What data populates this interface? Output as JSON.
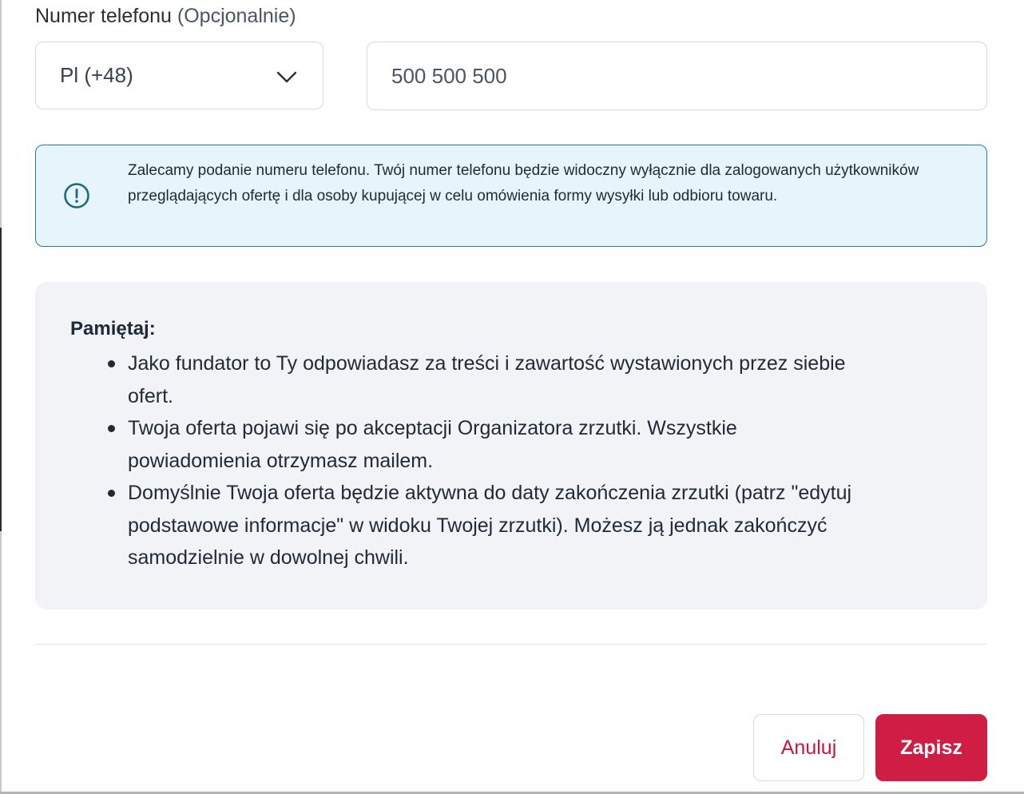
{
  "phone_field": {
    "label": "Numer telefonu",
    "label_optional": "(Opcjonalnie)",
    "country_select": {
      "selected": "Pl (+48)",
      "icon": "chevron-down-icon"
    },
    "phone_input": {
      "placeholder": "500 500 500",
      "value": ""
    }
  },
  "info_alert": {
    "icon": "info-circle-icon",
    "text": "Zalecamy podanie numeru telefonu. Twój numer telefonu będzie widoczny wyłącznie dla zalogowanych użytkowników przeglądających ofertę i dla osoby kupującej w celu omówienia formy wysyłki lub odbioru towaru.",
    "color_border": "#2b7a8f",
    "color_bg": "#e6f5fb"
  },
  "reminder": {
    "title": "Pamiętaj:",
    "items": [
      "Jako fundator to Ty odpowiadasz za treści i zawartość wystawionych przez siebie ofert.",
      "Twoja oferta pojawi się po akceptacji Organizatora zrzutki. Wszystkie powiadomienia otrzymasz mailem.",
      "Domyślnie Twoja oferta będzie aktywna do daty zakończenia zrzutki (patrz \"edytuj podstawowe informacje\" w widoku Twojej zrzutki). Możesz ją jednak zakończyć samodzielnie w dowolnej chwili."
    ]
  },
  "actions": {
    "cancel_label": "Anuluj",
    "save_label": "Zapisz",
    "accent_color": "#cf1d43"
  }
}
